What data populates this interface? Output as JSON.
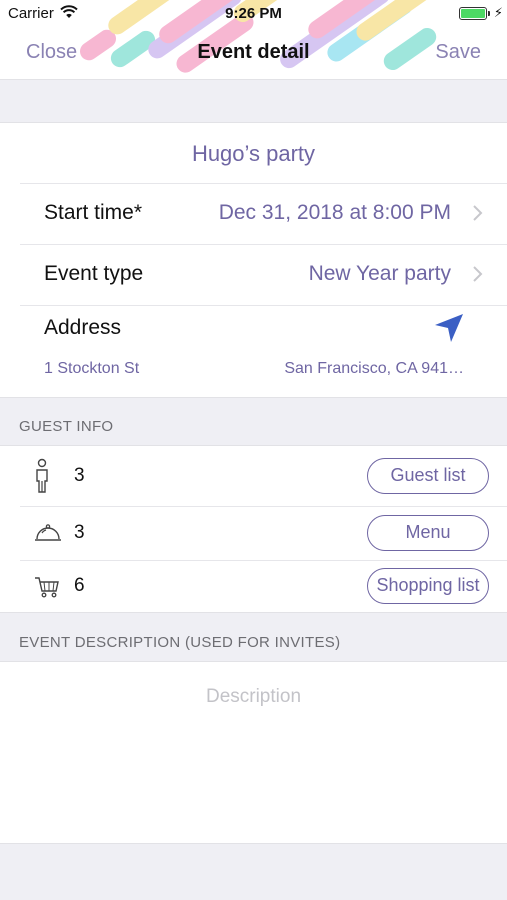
{
  "status_bar": {
    "carrier": "Carrier",
    "time": "9:26 PM",
    "battery_level": 1.0,
    "battery_color": "#4cd964"
  },
  "nav": {
    "close_label": "Close",
    "title": "Event detail",
    "save_label": "Save"
  },
  "event": {
    "name": "Hugo’s party",
    "start_time_label": "Start time*",
    "start_time_value": "Dec 31, 2018 at 8:00 PM",
    "event_type_label": "Event type",
    "event_type_value": "New Year party",
    "address_label": "Address",
    "address_street": "1 Stockton St",
    "address_city": "San Francisco, CA  941…"
  },
  "guest_info": {
    "header": "GUEST INFO",
    "rows": [
      {
        "icon": "person-icon",
        "count": "3",
        "button_label": "Guest list"
      },
      {
        "icon": "cloche-icon",
        "count": "3",
        "button_label": "Menu"
      },
      {
        "icon": "cart-icon",
        "count": "6",
        "button_label": "Shopping list"
      }
    ]
  },
  "description": {
    "header": "EVENT DESCRIPTION (USED FOR INVITES)",
    "placeholder": "Description",
    "value": ""
  },
  "colors": {
    "accent": "#6f66a3",
    "locate_arrow": "#3b5fc4",
    "background": "#efeff4"
  }
}
